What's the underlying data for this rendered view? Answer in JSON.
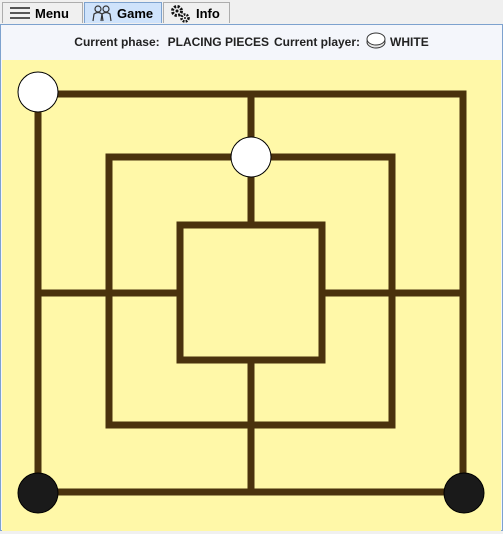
{
  "tabs": [
    {
      "label": "Menu",
      "icon": "hamburger-menu-icon",
      "selected": false
    },
    {
      "label": "Game",
      "icon": "players-icon",
      "selected": true
    },
    {
      "label": "Info",
      "icon": "gears-icon",
      "selected": false
    }
  ],
  "status": {
    "phase_label": "Current phase:",
    "phase_value": "PLACING PIECES",
    "player_label": "Current player:",
    "player_value": "WHITE",
    "player_icon": "white-stone-icon"
  },
  "colors": {
    "board_bg": "#fff8a8",
    "line": "#4a320d",
    "white_piece": "#ffffff",
    "black_piece": "#1a1a1a",
    "tab_selected": "#cfe3fb"
  },
  "pieces": [
    {
      "point": "outer-top-left",
      "color": "white"
    },
    {
      "point": "middle-top-center",
      "color": "white"
    },
    {
      "point": "outer-bottom-left",
      "color": "black"
    },
    {
      "point": "outer-bottom-right",
      "color": "black"
    }
  ]
}
